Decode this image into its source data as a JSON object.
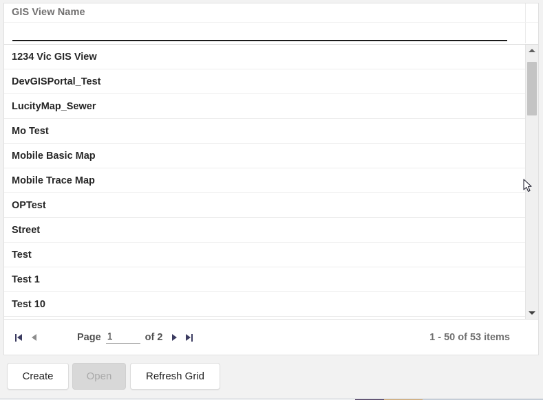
{
  "grid": {
    "column_header": "GIS View Name",
    "filter": {
      "value": "",
      "placeholder": ""
    },
    "rows": [
      {
        "name": "1234 Vic GIS View"
      },
      {
        "name": "DevGISPortal_Test"
      },
      {
        "name": "LucityMap_Sewer"
      },
      {
        "name": "Mo Test"
      },
      {
        "name": "Mobile Basic Map"
      },
      {
        "name": "Mobile Trace Map"
      },
      {
        "name": "OPTest"
      },
      {
        "name": "Street"
      },
      {
        "name": "Test"
      },
      {
        "name": "Test 1"
      },
      {
        "name": "Test 10"
      }
    ],
    "scrollbar": {
      "up_icon": "triangle-up-icon",
      "down_icon": "triangle-down-icon"
    }
  },
  "pager": {
    "first_icon": "first-page-icon",
    "prev_icon": "previous-page-icon",
    "next_icon": "next-page-icon",
    "last_icon": "last-page-icon",
    "page_label": "Page",
    "page_value": "1",
    "of_label": "of 2",
    "total_pages": "2",
    "items_summary": "1 - 50 of 53 items"
  },
  "toolbar": {
    "create_label": "Create",
    "open_label": "Open",
    "refresh_label": "Refresh Grid"
  },
  "colors": {
    "page_background": "#f2f2f2",
    "panel_background": "#ffffff",
    "header_text": "#706f6f",
    "row_text": "#262626",
    "row_divider": "#ededed",
    "filter_underline": "#1a1a1a",
    "scrollbar_track": "#f0f0f0",
    "scrollbar_thumb": "#c4c4c4",
    "pager_accent": "#3b3b60",
    "pager_muted": "#8d8d8d",
    "button_face": "#ffffff",
    "button_disabled": "#d8d8d8",
    "button_disabled_text": "#a9a9a9"
  }
}
